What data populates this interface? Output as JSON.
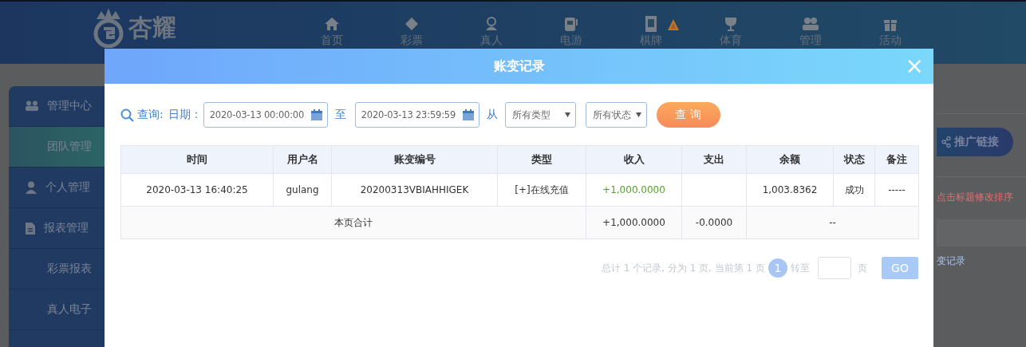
{
  "header": {
    "logo_text": "杏耀",
    "nav": [
      {
        "label": "首页"
      },
      {
        "label": "彩票"
      },
      {
        "label": "真人"
      },
      {
        "label": "电游"
      },
      {
        "label": "棋牌"
      },
      {
        "label": "体育"
      },
      {
        "label": "管理"
      },
      {
        "label": "活动"
      }
    ]
  },
  "sidebar": {
    "items": [
      {
        "kind": "section",
        "label": "管理中心",
        "selected": false
      },
      {
        "kind": "sub",
        "label": "团队管理",
        "selected": true
      },
      {
        "kind": "section",
        "label": "个人管理",
        "selected": false
      },
      {
        "kind": "section",
        "label": "报表管理",
        "selected": false
      },
      {
        "kind": "sub",
        "label": "彩票报表",
        "selected": false
      },
      {
        "kind": "sub",
        "label": "真人电子",
        "selected": false
      }
    ]
  },
  "background_panel": {
    "promo_button": "推广链接",
    "hint": "点击标题修改排序",
    "link": "变记录"
  },
  "modal": {
    "title": "账变记录",
    "close": "×",
    "query": {
      "label": "查询:",
      "date_label": "日期：",
      "from_value": "2020-03-13 00:00:00",
      "to_label": "至",
      "to_value": "2020-03-13 23:59:59",
      "from_label": "从",
      "type_select": "所有类型",
      "status_select": "所有状态",
      "button": "查 询"
    },
    "table": {
      "columns": [
        "时间",
        "用户名",
        "账变编号",
        "类型",
        "收入",
        "支出",
        "余额",
        "状态",
        "备注"
      ],
      "rows": [
        [
          "2020-03-13 16:40:25",
          "gulang",
          "20200313VBIAHHIGEK",
          "[+]在线充值",
          "+1,000.0000",
          "",
          "1,003.8362",
          "成功",
          "-----"
        ]
      ],
      "summary": {
        "label": "本页合计",
        "income": "+1,000.0000",
        "expense": "-0.0000",
        "rest": "--"
      }
    },
    "pagination": {
      "summary": "总计 1 个记录, 分为 1 页, 当前第 1 页",
      "pages": [
        {
          "label": "1",
          "selected": true
        }
      ],
      "goto_label": "转至",
      "page_label": "页",
      "go_button": "GO"
    }
  }
}
